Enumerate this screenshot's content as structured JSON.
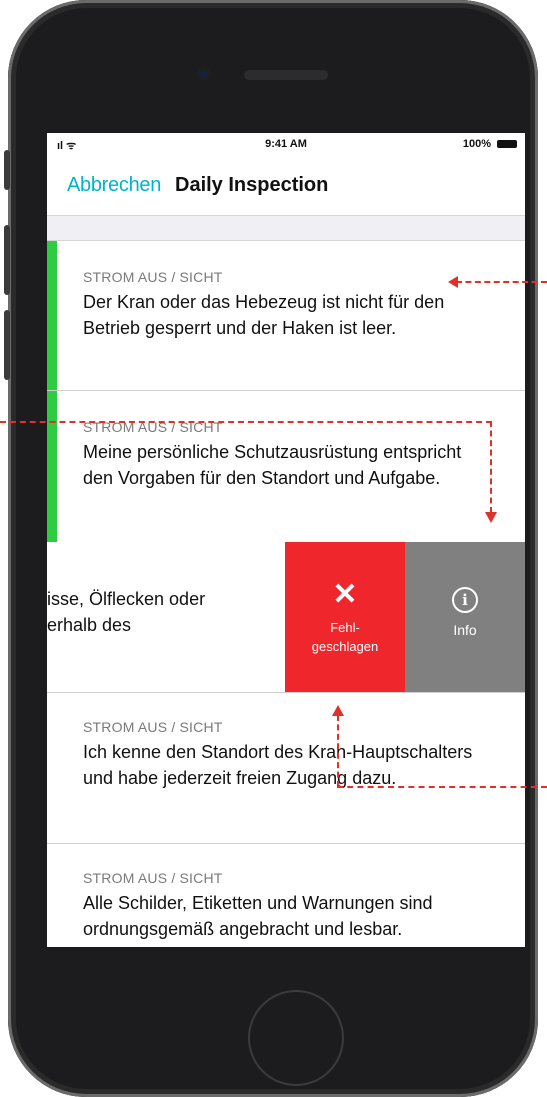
{
  "status_bar": {
    "time": "9:41 AM",
    "battery": "100%"
  },
  "nav": {
    "cancel": "Abbrechen",
    "title": "Daily Inspection"
  },
  "items": [
    {
      "category": "STROM AUS / SICHT",
      "text": "Der Kran oder das Hebezeug ist nicht für den Betrieb gesperrt und der Haken ist leer.",
      "status": "passed"
    },
    {
      "category": "STROM AUS / SICHT",
      "text": "Meine persönliche Schutzausrüstung entspricht den Vorgaben für den Standort und Aufgabe.",
      "status": "passed"
    },
    {
      "category": "STROM AUS / SICHT",
      "text": "Ich kenne den Standort des Kran-Hauptschalters und habe jederzeit freien Zugang dazu.",
      "status": "none"
    },
    {
      "category": "STROM AUS / SICHT",
      "text": "Alle Schilder, Etiketten und Warnungen sind ordnungsgemäß angebracht und lesbar.",
      "status": "none"
    }
  ],
  "swiped_item": {
    "line1": "isse, Ölflecken oder",
    "line2": "erhalb des",
    "fail_label_1": "Fehl-",
    "fail_label_2": "geschlagen",
    "info_label": "Info"
  },
  "icons": {
    "fail": "x-icon",
    "info": "info-circle-icon"
  },
  "colors": {
    "accent": "#00b4cc",
    "pass": "#2ecc40",
    "fail": "#f0262d",
    "info": "#808080",
    "annotation": "#e0302a"
  }
}
